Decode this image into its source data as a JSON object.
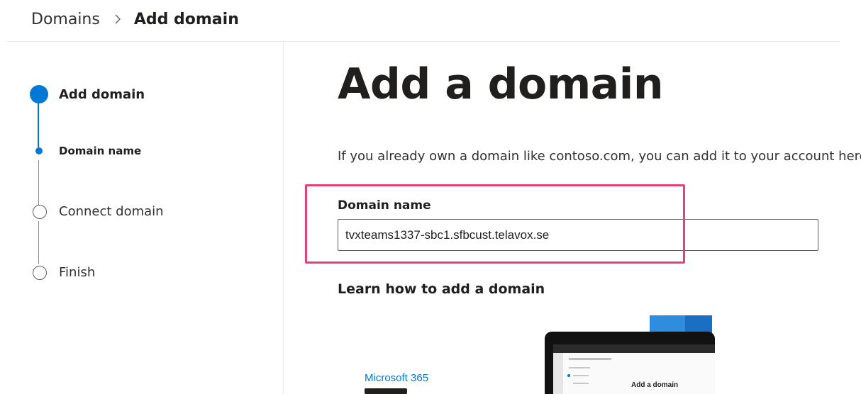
{
  "breadcrumb": {
    "parent": "Domains",
    "current": "Add domain"
  },
  "stepper": {
    "steps": [
      {
        "label": "Add domain",
        "state": "completed"
      },
      {
        "label": "Domain name",
        "state": "current"
      },
      {
        "label": "Connect domain",
        "state": "pending"
      },
      {
        "label": "Finish",
        "state": "pending"
      }
    ]
  },
  "main": {
    "title": "Add a domain",
    "intro": "If you already own a domain like contoso.com, you can add it to your account here.",
    "field_label": "Domain name",
    "field_value": "tvxteams1337-sbc1.sfbcust.telavox.se",
    "learn_title": "Learn how to add a domain"
  },
  "video": {
    "brand": "Microsoft 365",
    "screen_title": "Add a domain"
  },
  "colors": {
    "accent": "#0078d4",
    "highlight": "#e8417a"
  },
  "icons": {
    "breadcrumb_separator": "chevron-right-icon"
  }
}
